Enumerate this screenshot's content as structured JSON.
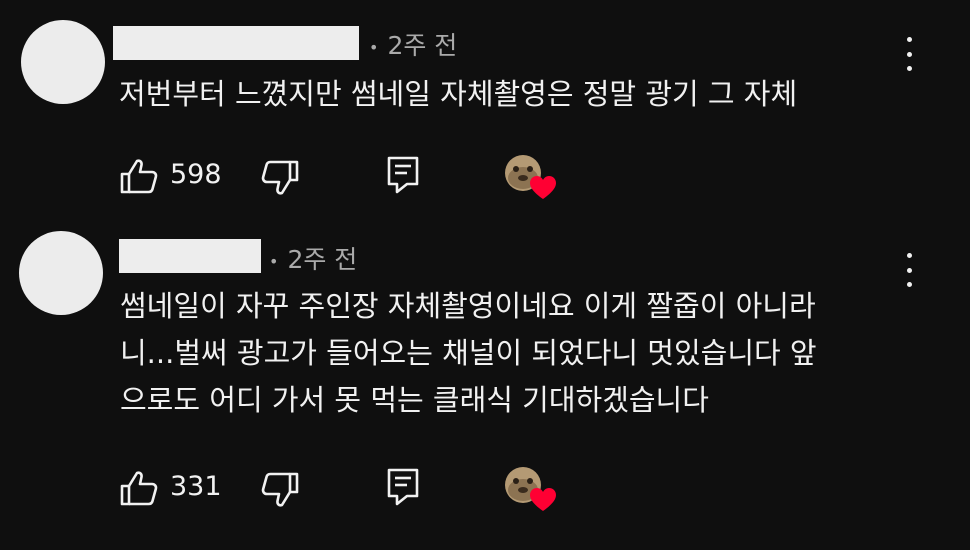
{
  "comments": [
    {
      "time": "2주 전",
      "text_lines": [
        "저번부터 느꼈지만 썸네일 자체촬영은 정말 광기 그 자체"
      ],
      "likes": "598"
    },
    {
      "time": "2주 전",
      "text_lines": [
        "썸네일이 자꾸 주인장 자체촬영이네요 이게 짤줍이 아니라",
        "니...벌써 광고가 들어오는 채널이 되었다니 멋있습니다 앞",
        "으로도 어디 가서 못 먹는 클래식 기대하겠습니다"
      ],
      "likes": "331"
    }
  ],
  "colors": {
    "background": "#0f0f0f",
    "text": "#f1f1f1",
    "meta": "#aaaaaa",
    "heart": "#ff0033"
  },
  "icons": [
    "like-icon",
    "dislike-icon",
    "reply-icon",
    "creator-heart-icon",
    "more-vert-icon"
  ]
}
